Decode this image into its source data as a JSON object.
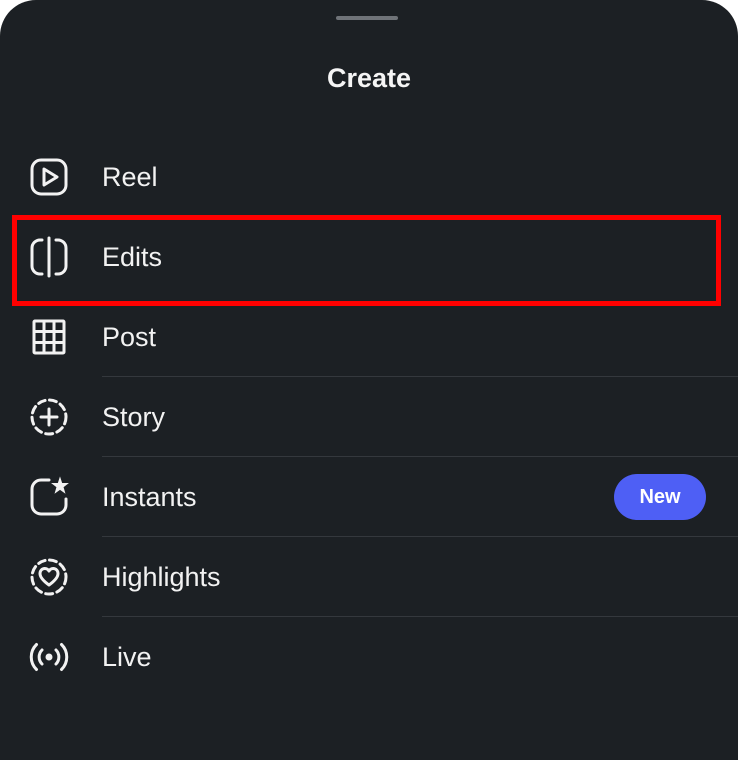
{
  "sheet": {
    "title": "Create"
  },
  "menu": {
    "items": [
      {
        "label": "Reel",
        "icon": "reel-icon"
      },
      {
        "label": "Edits",
        "icon": "edits-icon",
        "highlighted": true
      },
      {
        "label": "Post",
        "icon": "grid-icon"
      },
      {
        "label": "Story",
        "icon": "story-add-icon"
      },
      {
        "label": "Instants",
        "icon": "instants-icon",
        "badge": "New"
      },
      {
        "label": "Highlights",
        "icon": "highlights-heart-icon"
      },
      {
        "label": "Live",
        "icon": "live-broadcast-icon"
      }
    ]
  },
  "colors": {
    "background": "#1c2024",
    "text": "#f2f2f2",
    "badge": "#4e5ff5",
    "highlight_annotation": "#ff0000"
  }
}
